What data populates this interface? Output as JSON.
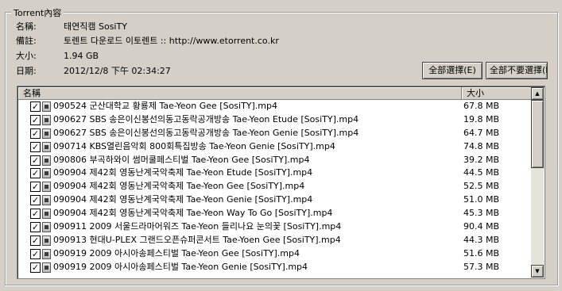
{
  "group_title": "Torrent內容",
  "info": [
    {
      "label": "名稱:",
      "value": "태연직캠 SosiTY"
    },
    {
      "label": "備註:",
      "value": "토렌트 다운로드 이토렌트 :: http://www.etorrent.co.kr"
    },
    {
      "label": "大小:",
      "value": "1.94 GB"
    },
    {
      "label": "日期:",
      "value": "2012/12/8 下午 02:34:27"
    }
  ],
  "buttons": {
    "select_all": "全部選擇(E)",
    "select_none": "全部不要選擇(N)"
  },
  "columns": {
    "name": "名稱",
    "size": "大小"
  },
  "checkmark": "✓",
  "icons": {
    "check": "checkbox-checked-icon",
    "file": "video-file-icon",
    "scroll_up": "arrow-up-icon",
    "scroll_down": "arrow-down-icon"
  },
  "files": [
    {
      "name": "090524 군산대학교 황룡제 Tae-Yeon Gee [SosiTY].mp4",
      "size": "67.8 MB"
    },
    {
      "name": "090627 SBS 송은이신봉선의동고동락공개방송 Tae-Yeon Etude [SosiTY].mp4",
      "size": "19.8 MB"
    },
    {
      "name": "090627 SBS 송은이신봉선의동고동락공개방송 Tae-Yeon Genie [SosiTY].mp4",
      "size": "64.7 MB"
    },
    {
      "name": "090714 KBS열린음악회 800회특집방송 Tae-Yeon Genie [SosiTY].mp4",
      "size": "74.8 MB"
    },
    {
      "name": "090806 부곡하와이 썸머쿨페스티벌 Tae-Yeon Gee [SosiTY].mp4",
      "size": "39.2 MB"
    },
    {
      "name": "090904 제42회 영동난계국악축제 Tae-Yeon Etude [SosiTY].mp4",
      "size": "44.5 MB"
    },
    {
      "name": "090904 제42회 영동난계국악축제 Tae-Yeon Gee [SosiTY].mp4",
      "size": "52.5 MB"
    },
    {
      "name": "090904 제42회 영동난계국악축제 Tae-Yeon Genie [SosiTY].mp4",
      "size": "51.0 MB"
    },
    {
      "name": "090904 제42회 영동난계국악축제 Tae-Yeon Way To Go [SosiTY].mp4",
      "size": "45.3 MB"
    },
    {
      "name": "090911 2009 서울드라마어워즈 Tae-Yeon 들리나요 눈의꽃 [SosiTY].mp4",
      "size": "90.4 MB"
    },
    {
      "name": "090913 현대U-PLEX 그랜드오픈슈퍼콘서트 Tae-Yoen Gee [SosiTY].mp4",
      "size": "44.3 MB"
    },
    {
      "name": "090919 2009 아시아송페스티벌 Tae-Yeon Gee [SosiTY].mp4",
      "size": "51.6 MB"
    },
    {
      "name": "090919 2009 아시아송페스티벌 Tae-Yeon Genie [SosiTY].mp4",
      "size": "57.3 MB"
    }
  ]
}
